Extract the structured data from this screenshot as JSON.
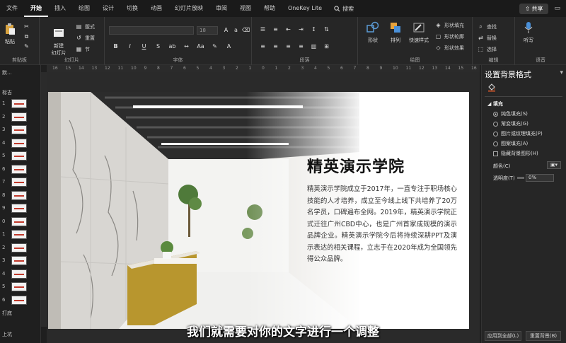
{
  "menu": {
    "tabs": [
      "文件",
      "开始",
      "插入",
      "绘图",
      "设计",
      "切换",
      "动画",
      "幻灯片放映",
      "审阅",
      "视图",
      "帮助",
      "OneKey Lite"
    ],
    "active_index": 1,
    "search_label": "搜索",
    "share_label": "共享"
  },
  "ribbon": {
    "clipboard": {
      "paste": "粘贴",
      "label": "剪贴板"
    },
    "slides": {
      "new_slide": "新建\n幻灯片",
      "layout": "版式",
      "reset": "重置",
      "section": "节",
      "label": "幻灯片"
    },
    "font": {
      "size": "18",
      "label": "字体"
    },
    "paragraph": {
      "label": "段落"
    },
    "drawing": {
      "shape": "形状",
      "arrange": "排列",
      "quick_style": "快速样式",
      "fill": "形状填充",
      "outline": "形状轮廓",
      "effect": "形状效果",
      "label": "绘图"
    },
    "editing": {
      "find": "查找",
      "replace": "替换",
      "select": "选择",
      "label": "编辑"
    },
    "voice": {
      "dictate": "听写",
      "label": "语音"
    }
  },
  "thumbs": {
    "section_top": "默...",
    "section_main": "标吉",
    "section_end": "打底",
    "section_last": "上坑",
    "numbers": [
      "1",
      "2",
      "3",
      "4",
      "5",
      "6",
      "7",
      "8",
      "9",
      "0",
      "1",
      "2",
      "3",
      "4",
      "5",
      "6"
    ]
  },
  "ruler": {
    "ticks": [
      "16",
      "15",
      "14",
      "13",
      "12",
      "11",
      "10",
      "9",
      "8",
      "7",
      "6",
      "5",
      "4",
      "3",
      "2",
      "1",
      "0",
      "1",
      "2",
      "3",
      "4",
      "5",
      "6",
      "7",
      "8",
      "9",
      "10",
      "11",
      "12",
      "13",
      "14",
      "15",
      "16"
    ]
  },
  "slide": {
    "title": "精英演示学院",
    "body": "精英演示学院成立于2017年，一直专注于职场核心技能的人才培养，成立至今线上线下共培养了20万名学员，口碑遍布全网。2019年，精英演示学院正式迁往广州CBD中心，也是广州首家成规模的演示品牌企业。精英演示学院今后将持续深耕PPT及演示表达的相关课程，立志于在2020年成为全国领先得公众品牌。"
  },
  "subtitle": "我们就需要对你的文字进行一个调整",
  "pane": {
    "title": "设置背景格式",
    "section": "填充",
    "options": [
      "纯色填充(S)",
      "渐变填充(G)",
      "图片或纹理填充(P)",
      "图案填充(A)"
    ],
    "selected_index": 0,
    "hide_bg": "隐藏背景图形(H)",
    "color_label": "颜色(C)",
    "transparency_label": "透明度(T)",
    "transparency_value": "0%",
    "apply_all": "应用到全部(L)",
    "reset_bg": "重置背景(B)"
  },
  "colors": {
    "accent_red": "#c0392b",
    "dark_bg": "#1f1f1f",
    "ribbon_bg": "#262626"
  }
}
